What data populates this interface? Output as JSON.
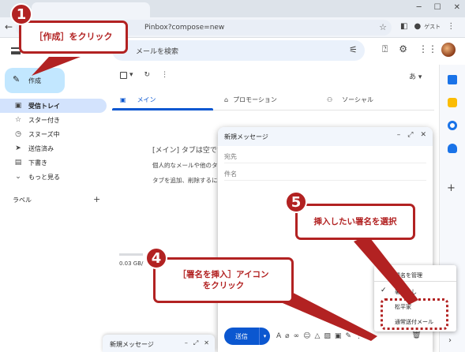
{
  "browser": {
    "url": "Pinbox?compose=new",
    "guest_label": "ゲスト"
  },
  "gmail": {
    "search_placeholder": "メールを検索",
    "compose_label": "作成",
    "nav": [
      {
        "icon": "inbox-icon",
        "label": "受信トレイ",
        "glyph": "▣",
        "active": true
      },
      {
        "icon": "star-icon",
        "label": "スター付き",
        "glyph": "☆",
        "active": false
      },
      {
        "icon": "clock-icon",
        "label": "スヌーズ中",
        "glyph": "◷",
        "active": false
      },
      {
        "icon": "send-icon",
        "label": "送信済み",
        "glyph": "➤",
        "active": false
      },
      {
        "icon": "file-icon",
        "label": "下書き",
        "glyph": "▤",
        "active": false
      },
      {
        "icon": "chevron-down-icon",
        "label": "もっと見る",
        "glyph": "⌄",
        "active": false
      }
    ],
    "labels_header": "ラベル",
    "lang_button": "あ",
    "tabs": [
      {
        "label": "メイン",
        "glyph": "▣"
      },
      {
        "label": "プロモーション",
        "glyph": "⌂"
      },
      {
        "label": "ソーシャル",
        "glyph": "⚇"
      }
    ],
    "empty_title": "[メイン] タブは空です",
    "empty_line1": "個人的なメールや他のタ",
    "empty_line2": "タブを追加、削除するに",
    "storage_text": "0.03 GB/"
  },
  "compose": {
    "title": "新規メッセージ",
    "to_placeholder": "宛先",
    "subject_placeholder": "件名",
    "send_label": "送信"
  },
  "signature_menu": {
    "manage": "署名を管理",
    "none": "署名なし",
    "option1": "松平家",
    "option2": "通常送付メール"
  },
  "mini_compose": {
    "title": "新規メッセージ"
  },
  "annotations": {
    "step1_number": "1",
    "step1_text": "［作成］をクリック",
    "step4_number": "4",
    "step4_line1": "［署名を挿入］アイコン",
    "step4_line2": "をクリック",
    "step5_number": "5",
    "step5_text": "挿入したい署名を選択"
  },
  "colors": {
    "accent": "#0b57d0",
    "compose_button": "#c2e7ff",
    "callout": "#b22222"
  }
}
